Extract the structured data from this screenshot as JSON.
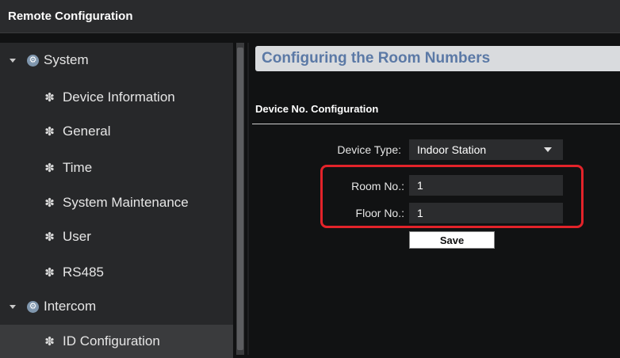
{
  "window": {
    "title": "Remote Configuration"
  },
  "sidebar": {
    "system": {
      "label": "System",
      "items": [
        {
          "label": "Device Information"
        },
        {
          "label": "General"
        },
        {
          "label": "Time"
        },
        {
          "label": "System Maintenance"
        },
        {
          "label": "User"
        },
        {
          "label": "RS485"
        }
      ]
    },
    "intercom": {
      "label": "Intercom",
      "items": [
        {
          "label": "ID Configuration",
          "selected": true
        }
      ]
    }
  },
  "main": {
    "header": "Configuring the Room Numbers",
    "section_title": "Device No. Configuration",
    "device_type": {
      "label": "Device Type:",
      "value": "Indoor Station"
    },
    "room_no": {
      "label": "Room No.:",
      "value": "1"
    },
    "floor_no": {
      "label": "Floor No.:",
      "value": "1"
    },
    "save_label": "Save"
  },
  "colors": {
    "highlight": "#e3232a",
    "header_text": "#5b79a6"
  }
}
